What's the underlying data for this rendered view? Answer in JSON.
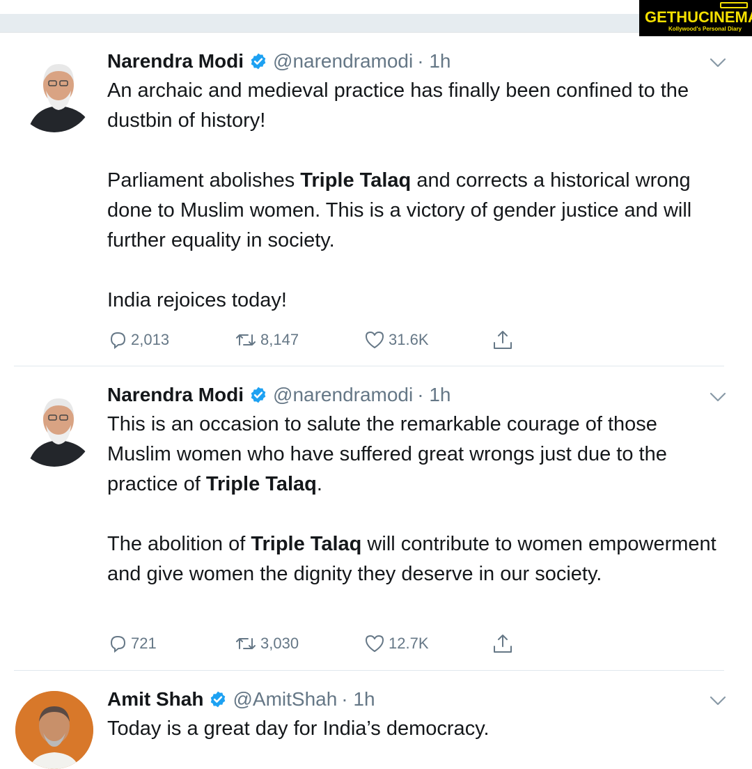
{
  "watermark": {
    "logo_text_1": "GETHU",
    "logo_text_2": "CINEMA",
    "tagline": "Kollywood's Personal Diary"
  },
  "tweets": [
    {
      "name": "Narendra Modi",
      "handle": "@narendramodi",
      "time": "· 1h",
      "paragraphs": [
        [
          {
            "t": "An archaic and medieval practice has finally been confined to the dustbin of history!"
          }
        ],
        [
          {
            "t": "Parliament abolishes "
          },
          {
            "t": "Triple Talaq",
            "b": true
          },
          {
            "t": " and corrects a historical wrong done to Muslim women. This is a victory of gender justice and will further equality in society."
          }
        ],
        [
          {
            "t": "India rejoices today!"
          }
        ]
      ],
      "replies": "2,013",
      "retweets": "8,147",
      "likes": "31.6K"
    },
    {
      "name": "Narendra Modi",
      "handle": "@narendramodi",
      "time": "· 1h",
      "paragraphs": [
        [
          {
            "t": "This is an occasion to salute the remarkable courage of those Muslim women who have suffered great wrongs just due to the practice of "
          },
          {
            "t": "Triple Talaq",
            "b": true
          },
          {
            "t": "."
          }
        ],
        [
          {
            "t": "The abolition of "
          },
          {
            "t": "Triple Talaq",
            "b": true
          },
          {
            "t": " will contribute to women empowerment and give women the dignity they deserve in our society."
          }
        ]
      ],
      "replies": "721",
      "retweets": "3,030",
      "likes": "12.7K"
    },
    {
      "name": "Amit Shah",
      "handle": "@AmitShah",
      "time": "· 1h",
      "paragraphs": [
        [
          {
            "t": "Today is a great day for India’s democracy."
          }
        ]
      ]
    }
  ],
  "icons": {
    "reply": "reply-icon",
    "retweet": "retweet-icon",
    "like": "heart-icon",
    "share": "share-icon",
    "verified": "verified-badge-icon",
    "menu": "chevron-down-icon"
  },
  "colors": {
    "text": "#14171a",
    "secondary": "#657786",
    "verified": "#1da1f2",
    "divider": "#e1e8ed"
  }
}
